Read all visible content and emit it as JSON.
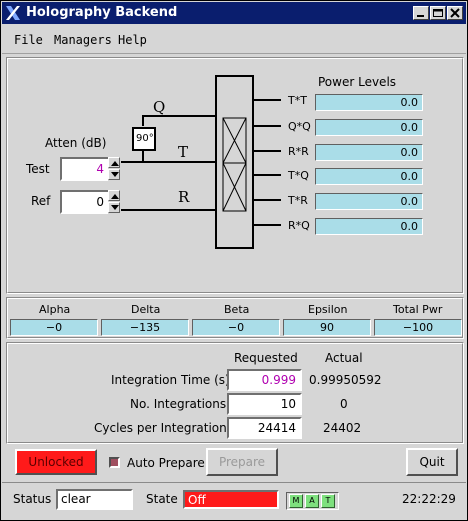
{
  "window": {
    "title": "Holography Backend"
  },
  "menu": {
    "file": "File",
    "managers": "Managers",
    "help": "Help"
  },
  "diagram": {
    "power_levels_title": "Power Levels",
    "atten_title": "Atten (dB)",
    "phase_label": "90°",
    "line_q": "Q",
    "line_t": "T",
    "line_r": "R",
    "test_label": "Test",
    "test_value": "4",
    "ref_label": "Ref",
    "ref_value": "0",
    "outputs": [
      {
        "label": "T*T",
        "value": "0.0"
      },
      {
        "label": "Q*Q",
        "value": "0.0"
      },
      {
        "label": "R*R",
        "value": "0.0"
      },
      {
        "label": "T*Q",
        "value": "0.0"
      },
      {
        "label": "T*R",
        "value": "0.0"
      },
      {
        "label": "R*Q",
        "value": "0.0"
      }
    ]
  },
  "params": [
    {
      "label": "Alpha",
      "value": "−0"
    },
    {
      "label": "Delta",
      "value": "−135"
    },
    {
      "label": "Beta",
      "value": "−0"
    },
    {
      "label": "Epsilon",
      "value": "90"
    },
    {
      "label": "Total Pwr",
      "value": "−100"
    }
  ],
  "integration": {
    "requested_header": "Requested",
    "actual_header": "Actual",
    "rows": [
      {
        "label": "Integration Time (s)",
        "requested": "0.999",
        "actual": "0.99950592"
      },
      {
        "label": "No. Integrations",
        "requested": "10",
        "actual": "0"
      },
      {
        "label": "Cycles per Integration",
        "requested": "24414",
        "actual": "24402"
      }
    ]
  },
  "controls": {
    "unlocked": "Unlocked",
    "auto_prepare": "Auto Prepare",
    "prepare": "Prepare",
    "quit": "Quit"
  },
  "status": {
    "status_label": "Status",
    "status_value": "clear",
    "state_label": "State",
    "state_value": "Off",
    "indicators": [
      "M",
      "A",
      "T"
    ],
    "time": "22:22:29"
  },
  "colors": {
    "titlebar": "#0a1e6e",
    "readout": "#aadde8",
    "alarm": "#ff1a1a",
    "indicator": "#7ee07e",
    "magenta_text": "#b000b0"
  }
}
